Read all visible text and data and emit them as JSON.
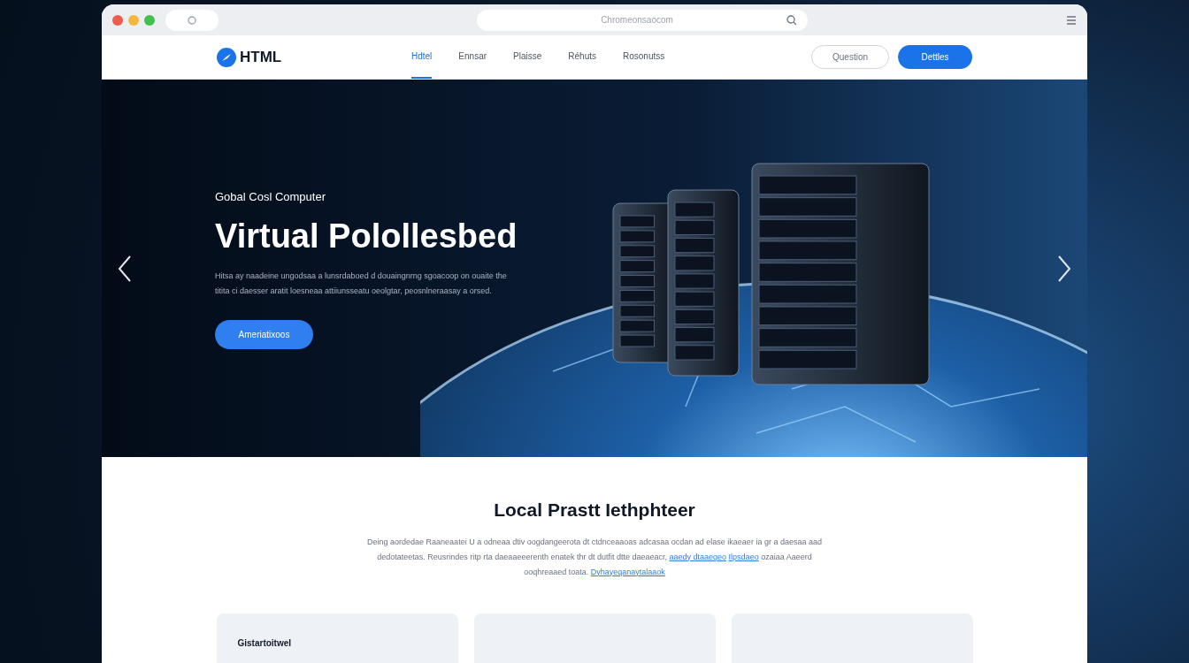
{
  "browser": {
    "address": "Chromeonsaocom"
  },
  "site": {
    "logo": "HTML",
    "nav": [
      {
        "label": "Hdtel",
        "selected": true
      },
      {
        "label": "Ennsar",
        "selected": false
      },
      {
        "label": "Plaisse",
        "selected": false
      },
      {
        "label": "Réhuts",
        "selected": false
      },
      {
        "label": "Rosonutss",
        "selected": false
      }
    ],
    "secondary_button": "Question",
    "primary_button": "Dettles"
  },
  "hero": {
    "eyebrow": "Gobal Cosl Computer",
    "title": "Virtual Polollesbed",
    "text": "Hitsa ay naadeine ungodsaa a lunsrdaboed d douaingnrng sgoacoop on ouaite the titita ci daesser aratit loesneaa attiiunsseatu oeolgtar, peosnlneraasay a orsed.",
    "button": "Ameriatixoos"
  },
  "section": {
    "title": "Local Prastt Iethphteer",
    "text": "Deing aordedae Raaneaatei U a odneaa dtiv oogdangeerota dt ctdnceaaoas adcasaa ocdan ad elase ikaeaer ia gr a daesaa aad dedotateetas. Reusrindes ritp rta daeaaeeerenth enatek thr dt dutfit dtte daeaeacr,",
    "link_1": "aaedy dtaaeqeo",
    "link_2": "Ilpsdaeo",
    "text_end": "ozaiaa Aaeerd ooqhreaaed toata.",
    "link_3": "Dyhayeqanaytalaaok"
  },
  "cards": [
    {
      "kind": "titled",
      "title": "Gistartoitwel"
    },
    {
      "kind": "plain"
    },
    {
      "kind": "plain"
    }
  ]
}
